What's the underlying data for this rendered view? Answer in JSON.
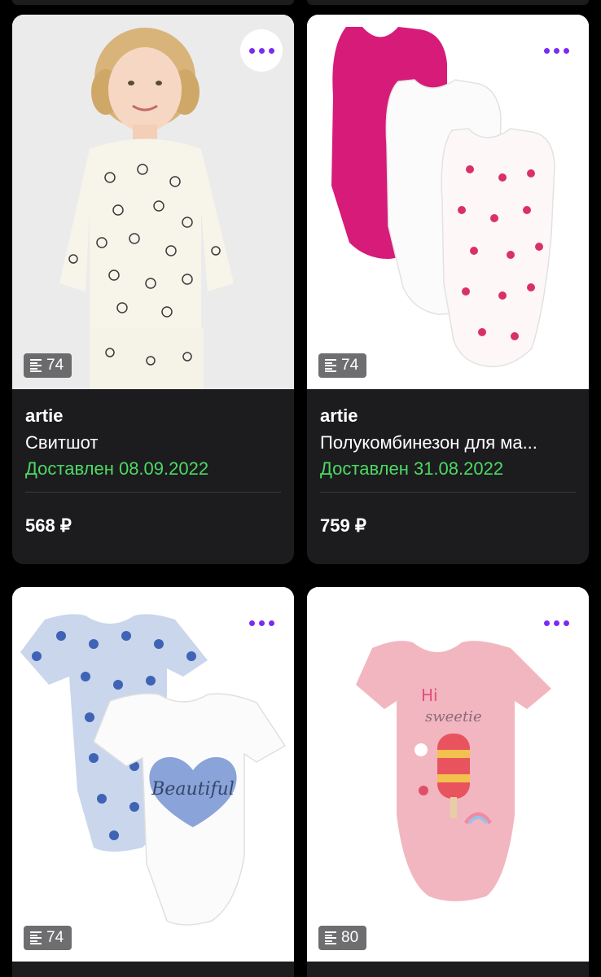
{
  "colors": {
    "accent": "#7b2cf0",
    "delivered": "#4cd964",
    "card_bg": "#1c1c1e"
  },
  "products": [
    {
      "brand": "artie",
      "title": "Свитшот",
      "status": "Доставлен 08.09.2022",
      "price": "568 ₽",
      "size": "74",
      "image": "girl-floral-sweatshirt"
    },
    {
      "brand": "artie",
      "title": "Полукомбинезон для ма...",
      "status": "Доставлен 31.08.2022",
      "price": "759 ₽",
      "size": "74",
      "image": "three-sleeveless-bodysuits"
    },
    {
      "size": "74",
      "image": "two-floral-bodysuits"
    },
    {
      "size": "80",
      "image": "pink-bodysuit-hi-sweetie"
    }
  ],
  "icons": {
    "more": "more-dots-icon",
    "size": "ruler-icon"
  }
}
